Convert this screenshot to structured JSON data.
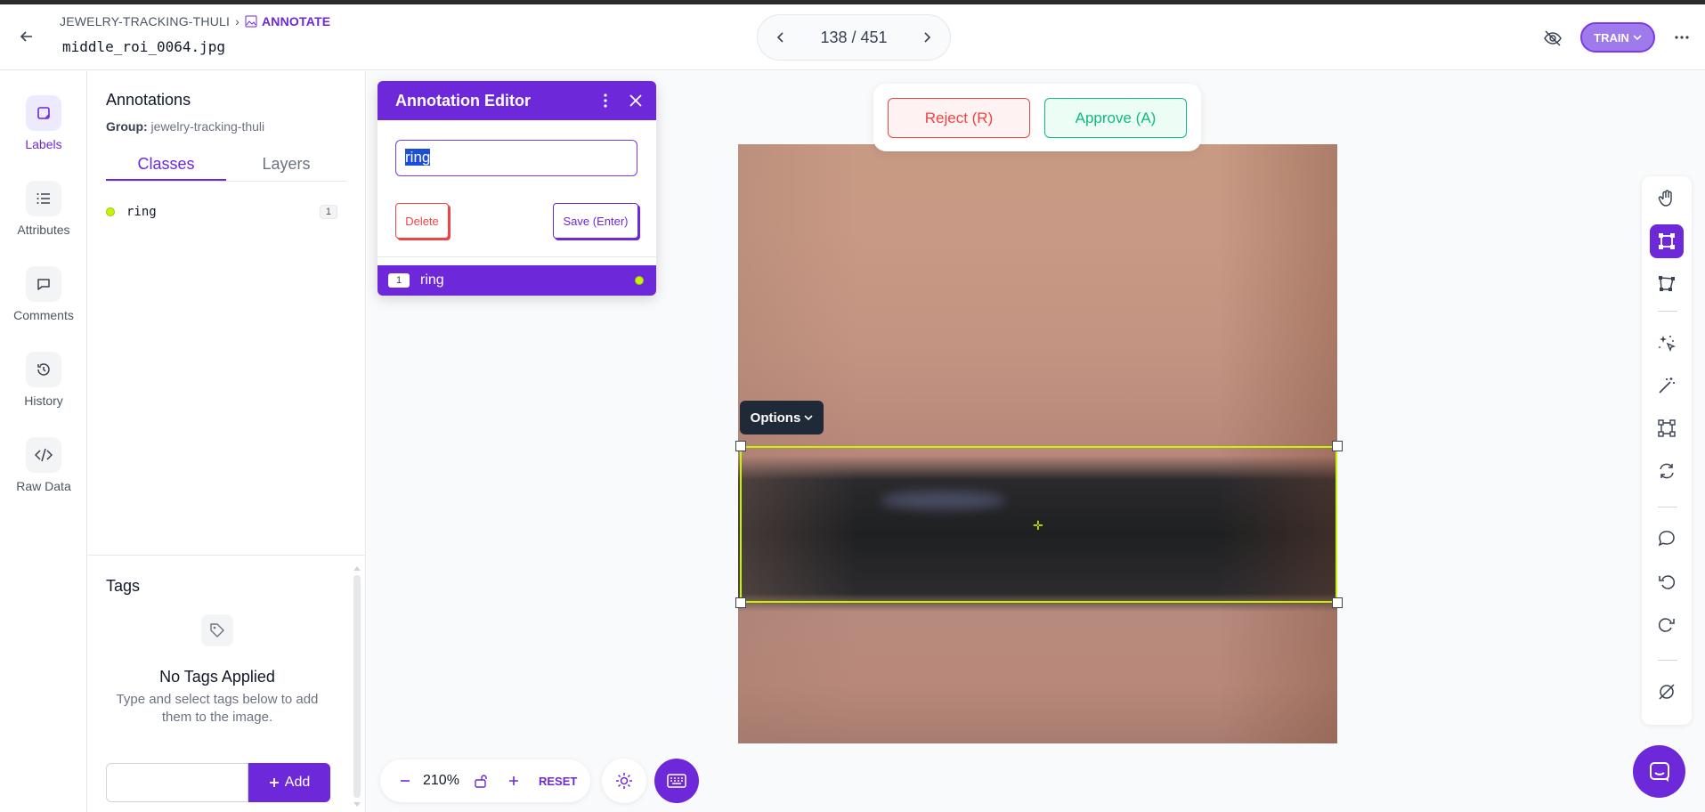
{
  "header": {
    "breadcrumb_project": "JEWELRY-TRACKING-THULI",
    "breadcrumb_current": "ANNOTATE",
    "filename": "middle_roi_0064.jpg",
    "pager": "138 / 451",
    "train_label": "TRAIN"
  },
  "rail": {
    "items": [
      {
        "label": "Labels",
        "icon": "labels-icon"
      },
      {
        "label": "Attributes",
        "icon": "list-icon"
      },
      {
        "label": "Comments",
        "icon": "comment-icon"
      },
      {
        "label": "History",
        "icon": "history-icon"
      },
      {
        "label": "Raw Data",
        "icon": "code-icon"
      }
    ]
  },
  "panel": {
    "title": "Annotations",
    "group_label": "Group:",
    "group_value": "jewelry-tracking-thuli",
    "tabs": [
      "Classes",
      "Layers"
    ],
    "classes": [
      {
        "name": "ring",
        "count": "1",
        "color": "#c6f500"
      }
    ],
    "tags_title": "Tags",
    "no_tags_title": "No Tags Applied",
    "no_tags_sub": "Type and select tags below to add them to the image.",
    "add_label": "Add"
  },
  "editor": {
    "title": "Annotation Editor",
    "input_value": "ring",
    "delete_label": "Delete",
    "save_label": "Save (Enter)",
    "item_index": "1",
    "item_label": "ring"
  },
  "review": {
    "reject_label": "Reject (R)",
    "approve_label": "Approve (A)"
  },
  "canvas": {
    "options_label": "Options"
  },
  "zoom": {
    "value": "210%",
    "reset_label": "RESET"
  },
  "colors": {
    "accent": "#6d28d9",
    "bbox": "#c6f500",
    "reject": "#ef4444",
    "approve": "#10b981"
  }
}
